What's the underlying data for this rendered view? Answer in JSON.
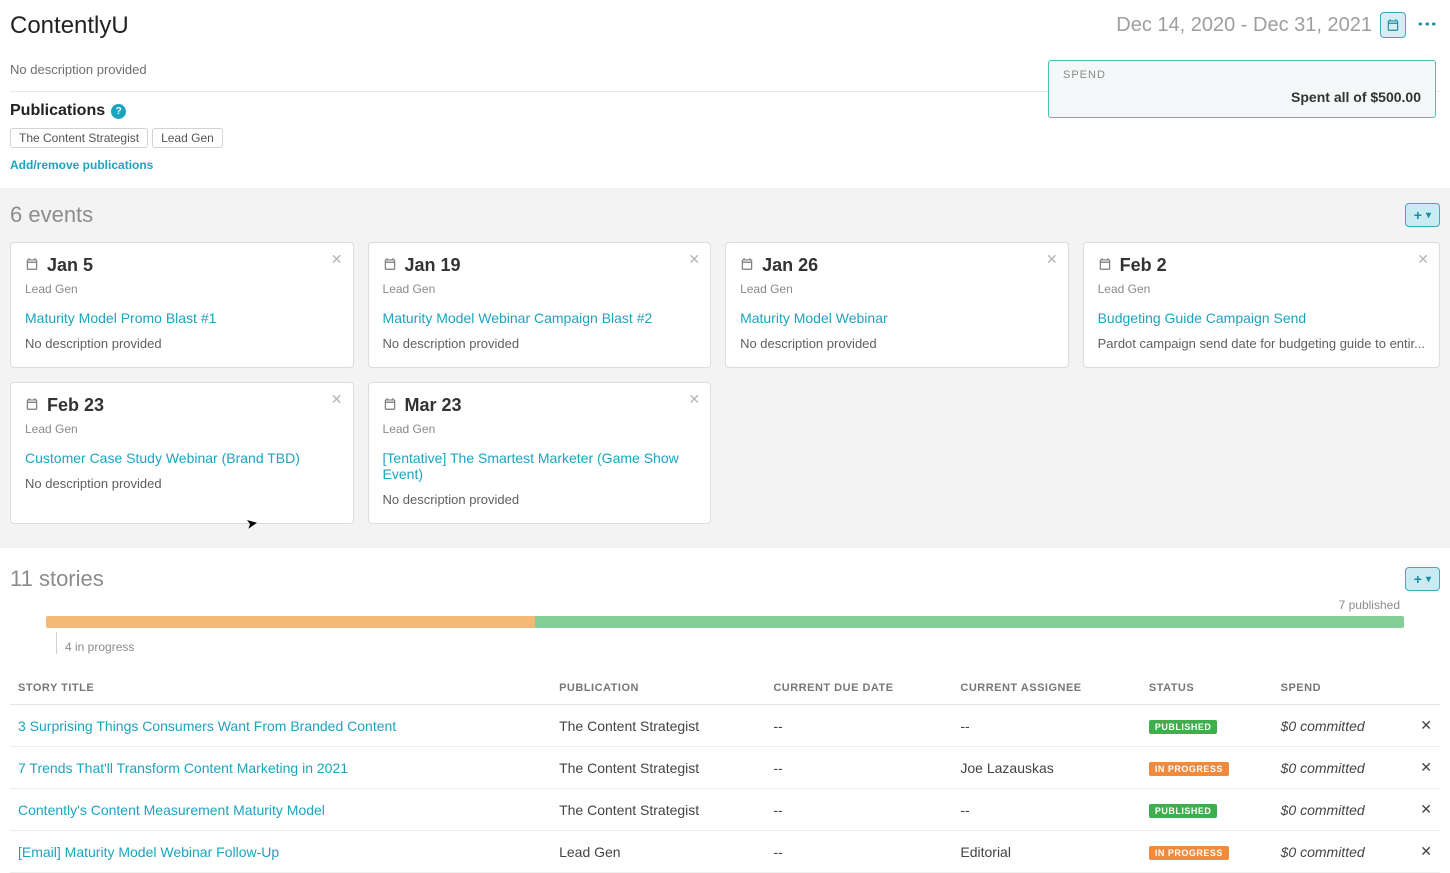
{
  "header": {
    "title": "ContentlyU",
    "date_range": "Dec 14, 2020 - Dec 31, 2021",
    "description": "No description provided"
  },
  "spend": {
    "label": "SPEND",
    "value": "Spent all of $500.00"
  },
  "publications": {
    "title": "Publications",
    "items": [
      "The Content Strategist",
      "Lead Gen"
    ],
    "action": "Add/remove publications"
  },
  "events": {
    "count_label": "6 events",
    "cards": [
      {
        "date": "Jan 5",
        "category": "Lead Gen",
        "title": "Maturity Model Promo Blast #1",
        "desc": "No description provided"
      },
      {
        "date": "Jan 19",
        "category": "Lead Gen",
        "title": "Maturity Model Webinar Campaign Blast #2",
        "desc": "No description provided"
      },
      {
        "date": "Jan 26",
        "category": "Lead Gen",
        "title": "Maturity Model Webinar",
        "desc": "No description provided"
      },
      {
        "date": "Feb 2",
        "category": "Lead Gen",
        "title": "Budgeting Guide Campaign Send",
        "desc": "Pardot campaign send date for budgeting guide to entir..."
      },
      {
        "date": "Feb 23",
        "category": "Lead Gen",
        "title": "Customer Case Study Webinar (Brand TBD)",
        "desc": "No description provided"
      },
      {
        "date": "Mar 23",
        "category": "Lead Gen",
        "title": "[Tentative] The Smartest Marketer (Game Show Event)",
        "desc": "No description provided"
      }
    ]
  },
  "stories": {
    "count_label": "11 stories",
    "published_label": "7 published",
    "inprogress_label": "4 in progress",
    "progress_split": {
      "orange_pct": 36,
      "green_pct": 64
    },
    "columns": [
      "STORY TITLE",
      "PUBLICATION",
      "CURRENT DUE DATE",
      "CURRENT ASSIGNEE",
      "STATUS",
      "SPEND"
    ],
    "rows": [
      {
        "title": "3 Surprising Things Consumers Want From Branded Content",
        "publication": "The Content Strategist",
        "due": "--",
        "assignee": "--",
        "status": "PUBLISHED",
        "status_kind": "published",
        "spend": "$0 committed"
      },
      {
        "title": "7 Trends That'll Transform Content Marketing in 2021",
        "publication": "The Content Strategist",
        "due": "--",
        "assignee": "Joe Lazauskas",
        "status": "IN PROGRESS",
        "status_kind": "inprogress",
        "spend": "$0 committed"
      },
      {
        "title": "Contently's Content Measurement Maturity Model",
        "publication": "The Content Strategist",
        "due": "--",
        "assignee": "--",
        "status": "PUBLISHED",
        "status_kind": "published",
        "spend": "$0 committed"
      },
      {
        "title": "[Email] Maturity Model Webinar Follow-Up",
        "publication": "Lead Gen",
        "due": "--",
        "assignee": "Editorial",
        "status": "IN PROGRESS",
        "status_kind": "inprogress",
        "spend": "$0 committed"
      }
    ]
  }
}
